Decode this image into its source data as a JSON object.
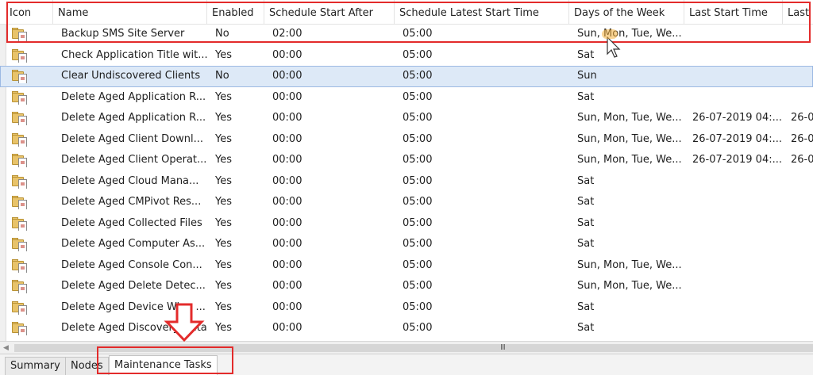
{
  "columns": [
    {
      "key": "icon",
      "label": "Icon"
    },
    {
      "key": "name",
      "label": "Name"
    },
    {
      "key": "enabled",
      "label": "Enabled"
    },
    {
      "key": "start_after",
      "label": "Schedule Start After"
    },
    {
      "key": "latest_start",
      "label": "Schedule Latest Start Time"
    },
    {
      "key": "days",
      "label": "Days of the Week"
    },
    {
      "key": "last_start",
      "label": "Last Start Time"
    },
    {
      "key": "last_other",
      "label": "Last"
    }
  ],
  "rows": [
    {
      "icon": "task-icon",
      "name": "Backup SMS Site Server",
      "enabled": "No",
      "start_after": "02:00",
      "latest_start": "05:00",
      "days": "Sun, Mon, Tue, We...",
      "last_start": "",
      "last_other": ""
    },
    {
      "icon": "task-icon",
      "name": "Check Application Title wit...",
      "enabled": "Yes",
      "start_after": "00:00",
      "latest_start": "05:00",
      "days": "Sat",
      "last_start": "",
      "last_other": ""
    },
    {
      "icon": "task-icon",
      "name": "Clear Undiscovered Clients",
      "enabled": "No",
      "start_after": "00:00",
      "latest_start": "05:00",
      "days": "Sun",
      "last_start": "",
      "last_other": ""
    },
    {
      "icon": "task-icon",
      "name": "Delete Aged Application R...",
      "enabled": "Yes",
      "start_after": "00:00",
      "latest_start": "05:00",
      "days": "Sat",
      "last_start": "",
      "last_other": ""
    },
    {
      "icon": "task-icon",
      "name": "Delete Aged Application R...",
      "enabled": "Yes",
      "start_after": "00:00",
      "latest_start": "05:00",
      "days": "Sun, Mon, Tue, We...",
      "last_start": "26-07-2019 04:...",
      "last_other": "26-0"
    },
    {
      "icon": "task-icon",
      "name": "Delete Aged Client Downl...",
      "enabled": "Yes",
      "start_after": "00:00",
      "latest_start": "05:00",
      "days": "Sun, Mon, Tue, We...",
      "last_start": "26-07-2019 04:...",
      "last_other": "26-0"
    },
    {
      "icon": "task-icon",
      "name": "Delete Aged Client Operat...",
      "enabled": "Yes",
      "start_after": "00:00",
      "latest_start": "05:00",
      "days": "Sun, Mon, Tue, We...",
      "last_start": "26-07-2019 04:...",
      "last_other": "26-0"
    },
    {
      "icon": "task-icon",
      "name": "Delete Aged Cloud Mana...",
      "enabled": "Yes",
      "start_after": "00:00",
      "latest_start": "05:00",
      "days": "Sat",
      "last_start": "",
      "last_other": ""
    },
    {
      "icon": "task-icon",
      "name": "Delete Aged CMPivot Res...",
      "enabled": "Yes",
      "start_after": "00:00",
      "latest_start": "05:00",
      "days": "Sat",
      "last_start": "",
      "last_other": ""
    },
    {
      "icon": "task-icon",
      "name": "Delete Aged Collected Files",
      "enabled": "Yes",
      "start_after": "00:00",
      "latest_start": "05:00",
      "days": "Sat",
      "last_start": "",
      "last_other": ""
    },
    {
      "icon": "task-icon",
      "name": "Delete Aged Computer As...",
      "enabled": "Yes",
      "start_after": "00:00",
      "latest_start": "05:00",
      "days": "Sat",
      "last_start": "",
      "last_other": ""
    },
    {
      "icon": "task-icon",
      "name": "Delete Aged Console Con...",
      "enabled": "Yes",
      "start_after": "00:00",
      "latest_start": "05:00",
      "days": "Sun, Mon, Tue, We...",
      "last_start": "",
      "last_other": ""
    },
    {
      "icon": "task-icon",
      "name": "Delete Aged Delete Detec...",
      "enabled": "Yes",
      "start_after": "00:00",
      "latest_start": "05:00",
      "days": "Sun, Mon, Tue, We...",
      "last_start": "",
      "last_other": ""
    },
    {
      "icon": "task-icon",
      "name": "Delete Aged Device Wipe ...",
      "enabled": "Yes",
      "start_after": "00:00",
      "latest_start": "05:00",
      "days": "Sat",
      "last_start": "",
      "last_other": ""
    },
    {
      "icon": "task-icon",
      "name": "Delete Aged Discovery Data",
      "enabled": "Yes",
      "start_after": "00:00",
      "latest_start": "05:00",
      "days": "Sat",
      "last_start": "",
      "last_other": ""
    }
  ],
  "selected_row": 2,
  "hscroll": {
    "grip": "III"
  },
  "tabs": [
    {
      "label": "Summary",
      "active": false
    },
    {
      "label": "Nodes",
      "active": false
    },
    {
      "label": "Maintenance Tasks",
      "active": true
    }
  ],
  "colors": {
    "highlight_box": "#e32b2b",
    "selection": "#dde9f7"
  }
}
